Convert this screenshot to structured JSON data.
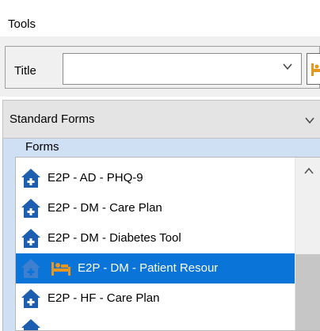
{
  "tools": {
    "header": "Tools"
  },
  "title_field": {
    "label": "Title",
    "value": ""
  },
  "standard_forms": {
    "selected": "Standard Forms"
  },
  "forms": {
    "group_label": "Forms",
    "items": [
      {
        "label": "E2P - AD - PHQ-9",
        "icon": "home-plus-icon",
        "selected": false
      },
      {
        "label": "E2P - DM - Care Plan",
        "icon": "home-plus-icon",
        "selected": false
      },
      {
        "label": "E2P - DM - Diabetes Tool",
        "icon": "home-plus-icon",
        "selected": false
      },
      {
        "label": "E2P - DM - Patient Resour",
        "icon": "home-plus-icon",
        "extra_icon": "bed-icon",
        "selected": true
      },
      {
        "label": "E2P - HF - Care Plan",
        "icon": "home-plus-icon",
        "selected": false
      }
    ]
  },
  "colors": {
    "selection": "#0a74d9",
    "panel": "#cfe0f5",
    "icon": "#1c5fb0",
    "bed_icon": "#e8961e"
  }
}
